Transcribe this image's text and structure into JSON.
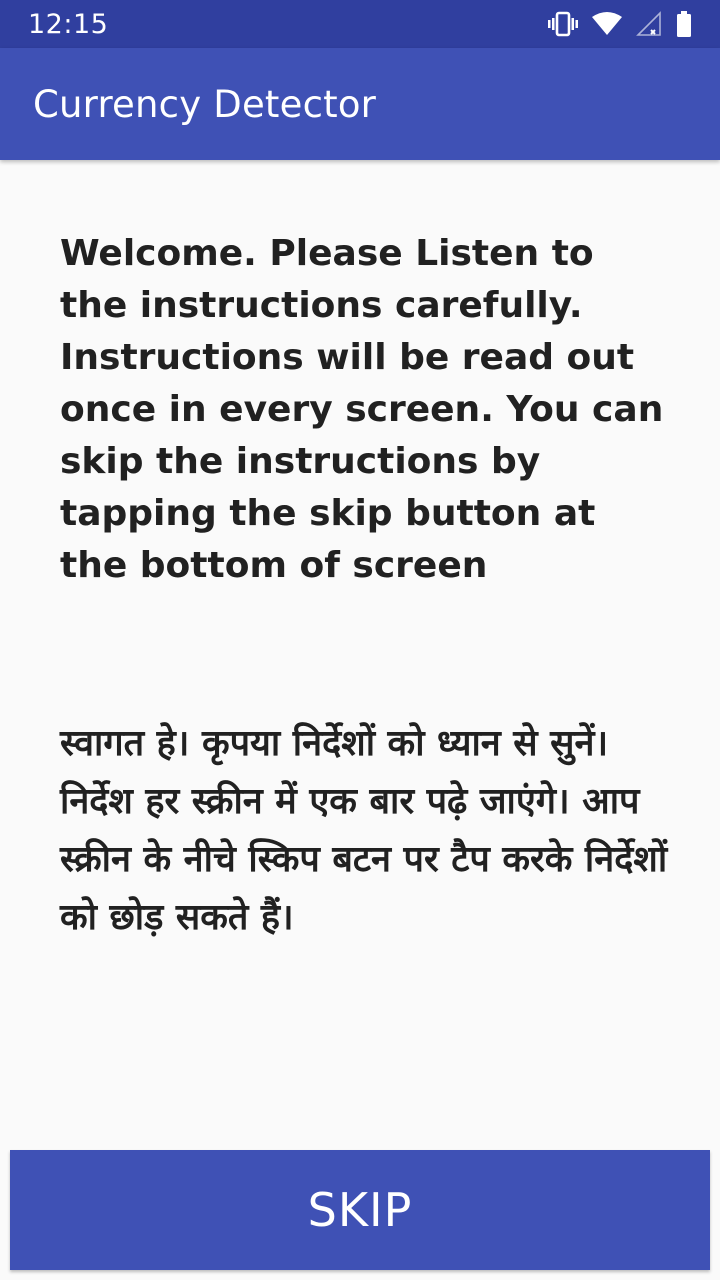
{
  "status_bar": {
    "time": "12:15",
    "icons": [
      "vibrate-icon",
      "wifi-icon",
      "cell-signal-icon",
      "battery-icon"
    ]
  },
  "app_bar": {
    "title": "Currency Detector"
  },
  "main": {
    "instructions_english": "Welcome. Please Listen to the instructions carefully. Instructions will be read out once in every screen. You can skip the instructions by tapping the skip button at the bottom of screen",
    "instructions_hindi": "स्वागत हे। कृपया निर्देशों को ध्यान से सुनें। निर्देश हर स्क्रीन में एक बार पढ़े जाएंगे। आप स्क्रीन के नीचे स्किप बटन पर टैप करके निर्देशों को छोड़ सकते हैं।"
  },
  "footer": {
    "skip_label": "SKIP"
  },
  "colors": {
    "status_bar": "#303f9f",
    "primary": "#3f51b5",
    "background": "#fafafa",
    "text": "#212121"
  }
}
